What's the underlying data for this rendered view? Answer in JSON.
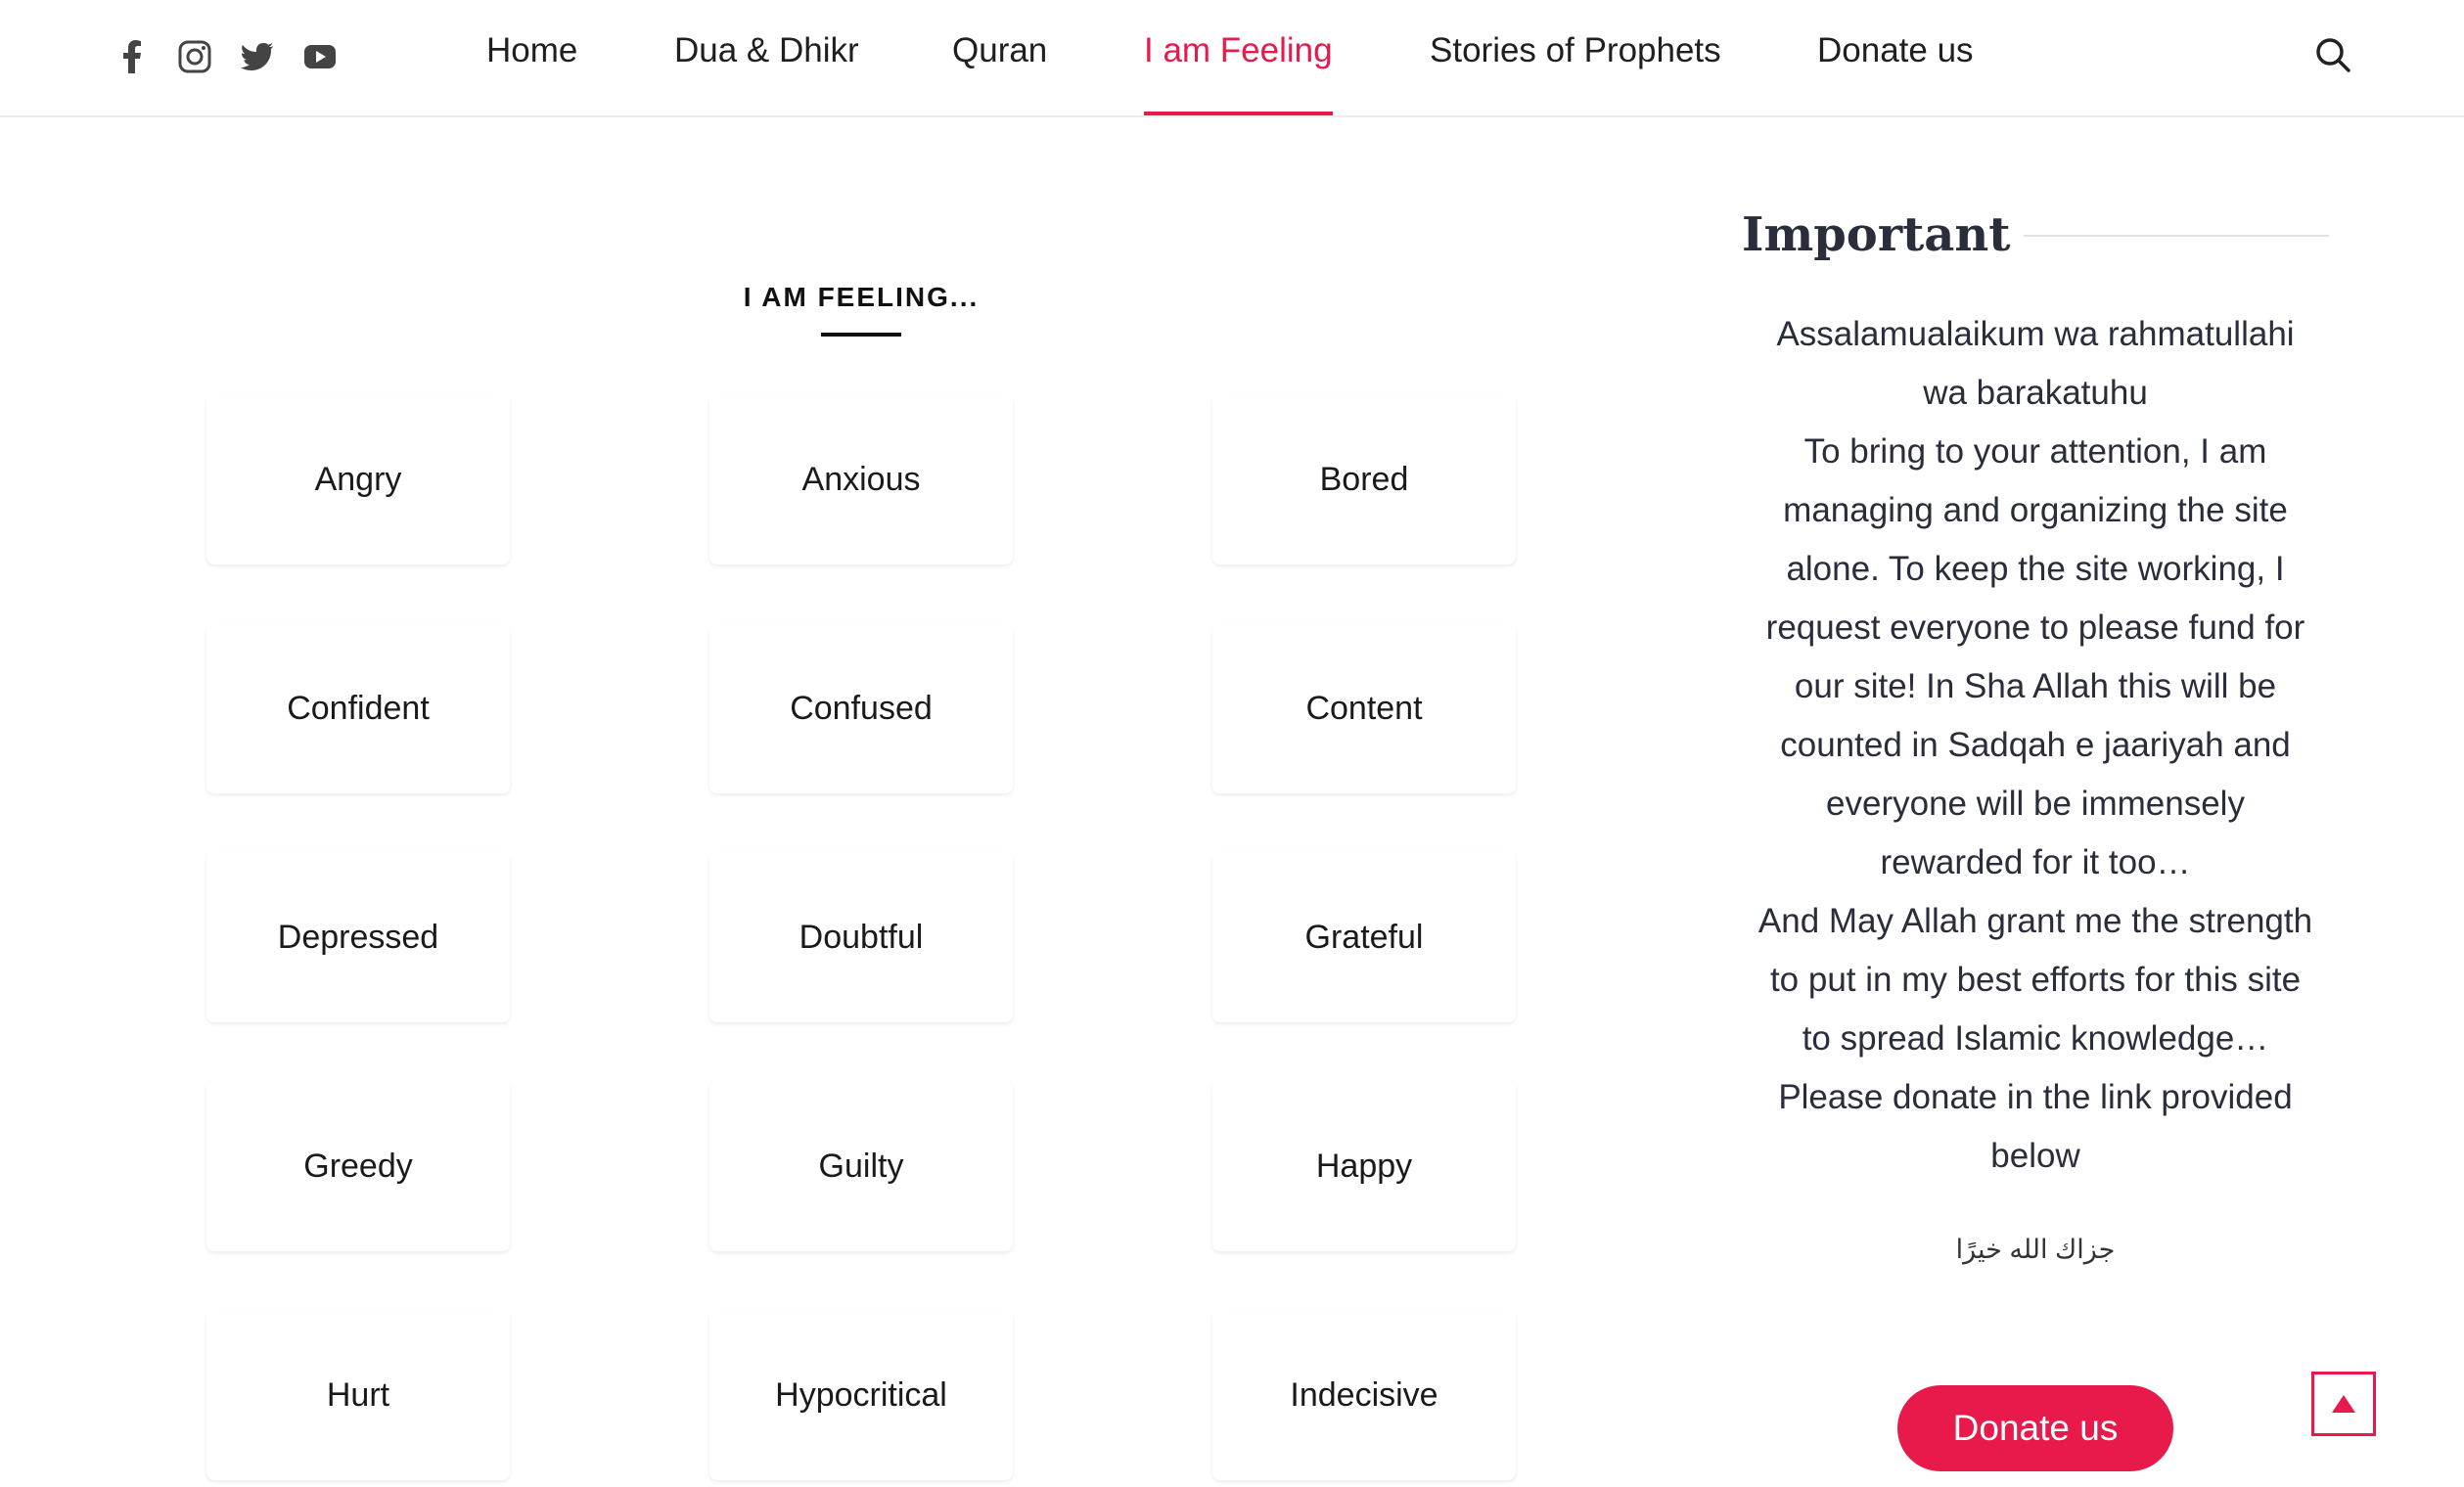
{
  "header": {
    "social": [
      {
        "name": "facebook-icon"
      },
      {
        "name": "instagram-icon"
      },
      {
        "name": "twitter-icon"
      },
      {
        "name": "youtube-icon"
      }
    ],
    "nav": [
      {
        "label": "Home",
        "active": false
      },
      {
        "label": "Dua & Dhikr",
        "active": false
      },
      {
        "label": "Quran",
        "active": false
      },
      {
        "label": "I am Feeling",
        "active": true
      },
      {
        "label": "Stories of Prophets",
        "active": false
      },
      {
        "label": "Donate us",
        "active": false
      }
    ],
    "search_icon": "search-icon"
  },
  "main": {
    "heading": "I AM FEELING...",
    "feelings": [
      {
        "label": "Angry",
        "color": "#efcccd"
      },
      {
        "label": "Anxious",
        "color": "#d9e9f6"
      },
      {
        "label": "Bored",
        "color": "#e2e2e2"
      },
      {
        "label": "Confident",
        "color": "#d8ebe4"
      },
      {
        "label": "Confused",
        "color": "#e8e0d1"
      },
      {
        "label": "Content",
        "color": "#fccbd1"
      },
      {
        "label": "Depressed",
        "color": "#f6bcd0"
      },
      {
        "label": "Doubtful",
        "color": "#efcccd"
      },
      {
        "label": "Grateful",
        "color": "#d9e9f6"
      },
      {
        "label": "Greedy",
        "color": "#e2e2e2"
      },
      {
        "label": "Guilty",
        "color": "#d8ebe4"
      },
      {
        "label": "Happy",
        "color": "#e8e0d1"
      },
      {
        "label": "Hurt",
        "color": "#fccbd1"
      },
      {
        "label": "Hypocritical",
        "color": "#f6bcd0"
      },
      {
        "label": "Indecisive",
        "color": "#efcccd"
      }
    ]
  },
  "sidebar": {
    "title": "Important",
    "lines": [
      "Assalamualaikum wa rahmatullahi",
      "wa barakatuhu",
      "To bring to your attention, I am",
      "managing and organizing the site",
      "alone. To keep the site working, I",
      "request everyone to please fund for",
      "our site! In Sha Allah this will be",
      "counted in Sadqah e jaariyah and",
      "everyone will be immensely",
      "rewarded for it too…",
      "And May Allah grant me the strength",
      "to put in my best efforts for this site",
      "to spread Islamic knowledge…",
      "Please donate in the link provided",
      "below"
    ],
    "arabic": "جزاك الله خيرًا",
    "donate_label": "Donate us"
  },
  "colors": {
    "accent": "#e8194b",
    "text": "#2a2d3a"
  },
  "scroll_top_icon": "arrow-up-icon"
}
